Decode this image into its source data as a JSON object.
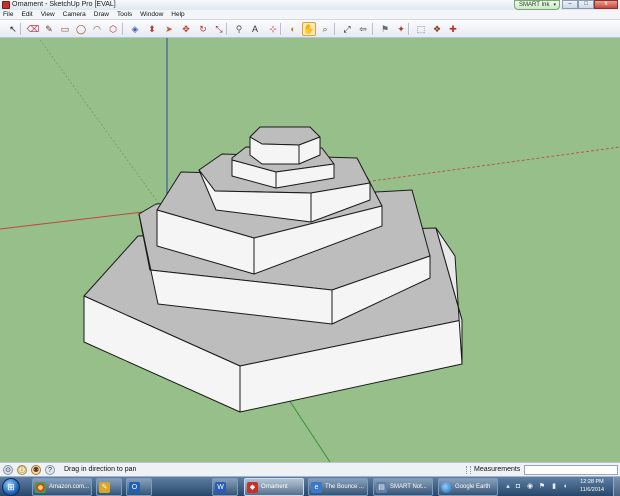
{
  "window": {
    "title": "Ornament - SketchUp Pro [EVAL]",
    "smart_ink_label": "SMART Ink",
    "minimize_glyph": "–",
    "maximize_glyph": "□",
    "close_glyph": "x"
  },
  "menu": {
    "items": [
      "File",
      "Edit",
      "View",
      "Camera",
      "Draw",
      "Tools",
      "Window",
      "Help"
    ]
  },
  "toolbar": {
    "tools": [
      {
        "name": "select",
        "icon": "select-arrow-icon",
        "glyph": "↖"
      },
      {
        "name": "eraser",
        "icon": "eraser-icon",
        "glyph": "⌫"
      },
      {
        "name": "line",
        "icon": "pencil-icon",
        "glyph": "✎"
      },
      {
        "name": "rectangle",
        "icon": "rectangle-icon",
        "glyph": "▭"
      },
      {
        "name": "circle",
        "icon": "circle-icon",
        "glyph": "◯"
      },
      {
        "name": "arc",
        "icon": "arc-icon",
        "glyph": "◠"
      },
      {
        "name": "polygon",
        "icon": "polygon-icon",
        "glyph": "⬡"
      },
      {
        "name": "paint-bucket",
        "icon": "paint-bucket-icon",
        "glyph": "◈"
      },
      {
        "name": "push-pull",
        "icon": "push-pull-icon",
        "glyph": "⬍"
      },
      {
        "name": "follow-me",
        "icon": "follow-me-icon",
        "glyph": "➤"
      },
      {
        "name": "move",
        "icon": "move-icon",
        "glyph": "✥"
      },
      {
        "name": "rotate",
        "icon": "rotate-icon",
        "glyph": "↻"
      },
      {
        "name": "scale",
        "icon": "scale-icon",
        "glyph": "⤡"
      },
      {
        "name": "tape-measure",
        "icon": "tape-measure-icon",
        "glyph": "⚲"
      },
      {
        "name": "text",
        "icon": "text-icon",
        "glyph": "A"
      },
      {
        "name": "axes",
        "icon": "axes-icon",
        "glyph": "⊹"
      },
      {
        "name": "orbit",
        "icon": "orbit-icon",
        "glyph": "◐"
      },
      {
        "name": "pan",
        "icon": "hand-pan-icon",
        "glyph": "✋"
      },
      {
        "name": "zoom",
        "icon": "zoom-icon",
        "glyph": "⌕"
      },
      {
        "name": "zoom-extents",
        "icon": "zoom-extents-icon",
        "glyph": "⤢"
      },
      {
        "name": "previous-view",
        "icon": "previous-view-icon",
        "glyph": "⇦"
      },
      {
        "name": "position-camera",
        "icon": "position-camera-icon",
        "glyph": "⚑"
      },
      {
        "name": "walk",
        "icon": "walk-icon",
        "glyph": "✦"
      },
      {
        "name": "get-models",
        "icon": "get-models-icon",
        "glyph": "⬚"
      },
      {
        "name": "components",
        "icon": "components-icon",
        "glyph": "❖"
      },
      {
        "name": "extension-warehouse",
        "icon": "extension-warehouse-icon",
        "glyph": "✚"
      }
    ],
    "active_tool": "pan"
  },
  "colors": {
    "sky_ground": "#97bf8a",
    "face_top": "#bdbdbd",
    "face_side": "#f5f5f5",
    "edge": "#1a1a1a",
    "axis_red": "#c0463c",
    "axis_green": "#3f8f3a",
    "axis_blue": "#3146a8"
  },
  "status": {
    "hint": "Drag in direction to pan",
    "measurements_label": "Measurements",
    "measurements_value": ""
  },
  "taskbar": {
    "tasks": [
      {
        "label": "Amazon.com...",
        "icon": "chrome-icon"
      },
      {
        "label": "",
        "icon": "pinned-app-icon"
      },
      {
        "label": "",
        "icon": "outlook-icon"
      },
      {
        "label": "",
        "icon": "word-icon"
      },
      {
        "label": "Ornament",
        "icon": "sketchup-icon"
      },
      {
        "label": "The Bounce ...",
        "icon": "explorer-icon"
      },
      {
        "label": "SMART Not...",
        "icon": "smart-notebook-icon"
      },
      {
        "label": "Google Earth",
        "icon": "google-earth-icon"
      }
    ],
    "clock_time": "12:28 PM",
    "clock_date": "11/6/2014"
  }
}
